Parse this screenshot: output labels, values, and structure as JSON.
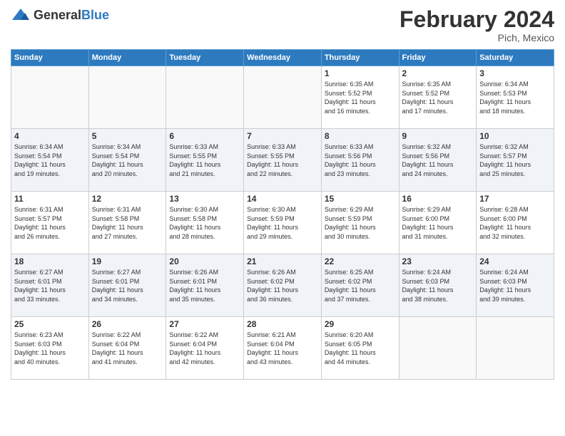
{
  "header": {
    "logo_general": "General",
    "logo_blue": "Blue",
    "month_year": "February 2024",
    "location": "Pich, Mexico"
  },
  "days_of_week": [
    "Sunday",
    "Monday",
    "Tuesday",
    "Wednesday",
    "Thursday",
    "Friday",
    "Saturday"
  ],
  "weeks": [
    {
      "shaded": false,
      "days": [
        {
          "number": "",
          "info": ""
        },
        {
          "number": "",
          "info": ""
        },
        {
          "number": "",
          "info": ""
        },
        {
          "number": "",
          "info": ""
        },
        {
          "number": "1",
          "info": "Sunrise: 6:35 AM\nSunset: 5:52 PM\nDaylight: 11 hours\nand 16 minutes."
        },
        {
          "number": "2",
          "info": "Sunrise: 6:35 AM\nSunset: 5:52 PM\nDaylight: 11 hours\nand 17 minutes."
        },
        {
          "number": "3",
          "info": "Sunrise: 6:34 AM\nSunset: 5:53 PM\nDaylight: 11 hours\nand 18 minutes."
        }
      ]
    },
    {
      "shaded": true,
      "days": [
        {
          "number": "4",
          "info": "Sunrise: 6:34 AM\nSunset: 5:54 PM\nDaylight: 11 hours\nand 19 minutes."
        },
        {
          "number": "5",
          "info": "Sunrise: 6:34 AM\nSunset: 5:54 PM\nDaylight: 11 hours\nand 20 minutes."
        },
        {
          "number": "6",
          "info": "Sunrise: 6:33 AM\nSunset: 5:55 PM\nDaylight: 11 hours\nand 21 minutes."
        },
        {
          "number": "7",
          "info": "Sunrise: 6:33 AM\nSunset: 5:55 PM\nDaylight: 11 hours\nand 22 minutes."
        },
        {
          "number": "8",
          "info": "Sunrise: 6:33 AM\nSunset: 5:56 PM\nDaylight: 11 hours\nand 23 minutes."
        },
        {
          "number": "9",
          "info": "Sunrise: 6:32 AM\nSunset: 5:56 PM\nDaylight: 11 hours\nand 24 minutes."
        },
        {
          "number": "10",
          "info": "Sunrise: 6:32 AM\nSunset: 5:57 PM\nDaylight: 11 hours\nand 25 minutes."
        }
      ]
    },
    {
      "shaded": false,
      "days": [
        {
          "number": "11",
          "info": "Sunrise: 6:31 AM\nSunset: 5:57 PM\nDaylight: 11 hours\nand 26 minutes."
        },
        {
          "number": "12",
          "info": "Sunrise: 6:31 AM\nSunset: 5:58 PM\nDaylight: 11 hours\nand 27 minutes."
        },
        {
          "number": "13",
          "info": "Sunrise: 6:30 AM\nSunset: 5:58 PM\nDaylight: 11 hours\nand 28 minutes."
        },
        {
          "number": "14",
          "info": "Sunrise: 6:30 AM\nSunset: 5:59 PM\nDaylight: 11 hours\nand 29 minutes."
        },
        {
          "number": "15",
          "info": "Sunrise: 6:29 AM\nSunset: 5:59 PM\nDaylight: 11 hours\nand 30 minutes."
        },
        {
          "number": "16",
          "info": "Sunrise: 6:29 AM\nSunset: 6:00 PM\nDaylight: 11 hours\nand 31 minutes."
        },
        {
          "number": "17",
          "info": "Sunrise: 6:28 AM\nSunset: 6:00 PM\nDaylight: 11 hours\nand 32 minutes."
        }
      ]
    },
    {
      "shaded": true,
      "days": [
        {
          "number": "18",
          "info": "Sunrise: 6:27 AM\nSunset: 6:01 PM\nDaylight: 11 hours\nand 33 minutes."
        },
        {
          "number": "19",
          "info": "Sunrise: 6:27 AM\nSunset: 6:01 PM\nDaylight: 11 hours\nand 34 minutes."
        },
        {
          "number": "20",
          "info": "Sunrise: 6:26 AM\nSunset: 6:01 PM\nDaylight: 11 hours\nand 35 minutes."
        },
        {
          "number": "21",
          "info": "Sunrise: 6:26 AM\nSunset: 6:02 PM\nDaylight: 11 hours\nand 36 minutes."
        },
        {
          "number": "22",
          "info": "Sunrise: 6:25 AM\nSunset: 6:02 PM\nDaylight: 11 hours\nand 37 minutes."
        },
        {
          "number": "23",
          "info": "Sunrise: 6:24 AM\nSunset: 6:03 PM\nDaylight: 11 hours\nand 38 minutes."
        },
        {
          "number": "24",
          "info": "Sunrise: 6:24 AM\nSunset: 6:03 PM\nDaylight: 11 hours\nand 39 minutes."
        }
      ]
    },
    {
      "shaded": false,
      "days": [
        {
          "number": "25",
          "info": "Sunrise: 6:23 AM\nSunset: 6:03 PM\nDaylight: 11 hours\nand 40 minutes."
        },
        {
          "number": "26",
          "info": "Sunrise: 6:22 AM\nSunset: 6:04 PM\nDaylight: 11 hours\nand 41 minutes."
        },
        {
          "number": "27",
          "info": "Sunrise: 6:22 AM\nSunset: 6:04 PM\nDaylight: 11 hours\nand 42 minutes."
        },
        {
          "number": "28",
          "info": "Sunrise: 6:21 AM\nSunset: 6:04 PM\nDaylight: 11 hours\nand 43 minutes."
        },
        {
          "number": "29",
          "info": "Sunrise: 6:20 AM\nSunset: 6:05 PM\nDaylight: 11 hours\nand 44 minutes."
        },
        {
          "number": "",
          "info": ""
        },
        {
          "number": "",
          "info": ""
        }
      ]
    }
  ]
}
